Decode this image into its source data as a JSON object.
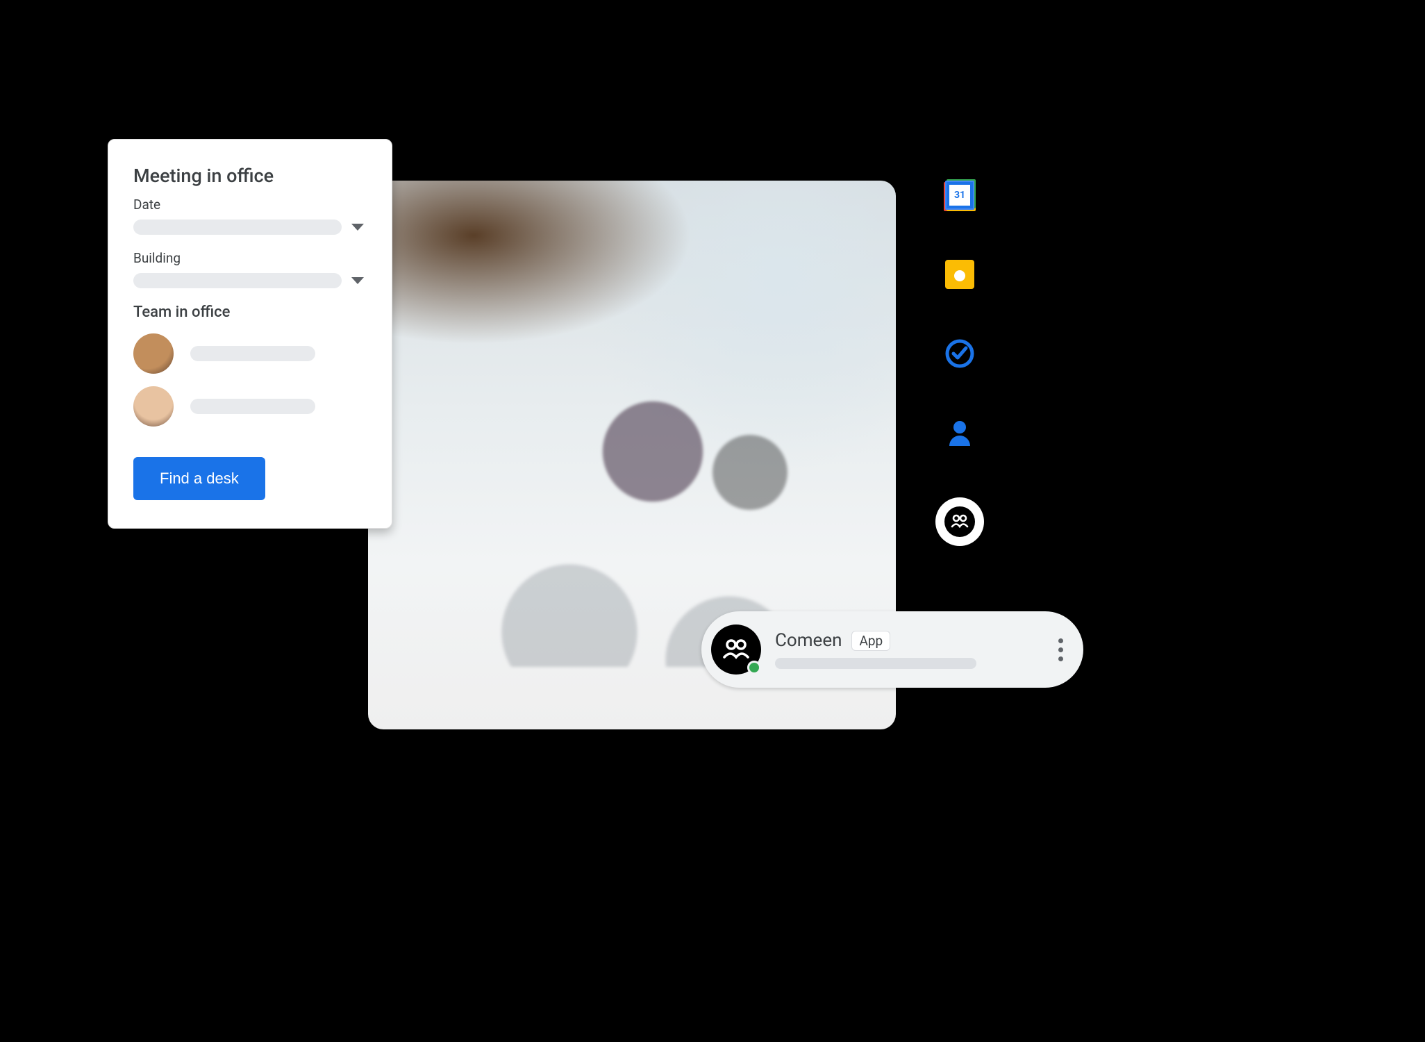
{
  "card": {
    "title": "Meeting in office",
    "date_label": "Date",
    "building_label": "Building",
    "team_title": "Team in office",
    "cta_label": "Find a desk"
  },
  "rail": {
    "calendar_day": "31",
    "icons": [
      "calendar-icon",
      "keep-icon",
      "tasks-icon",
      "contacts-icon",
      "comeen-icon"
    ]
  },
  "app_pill": {
    "name": "Comeen",
    "badge": "App"
  }
}
